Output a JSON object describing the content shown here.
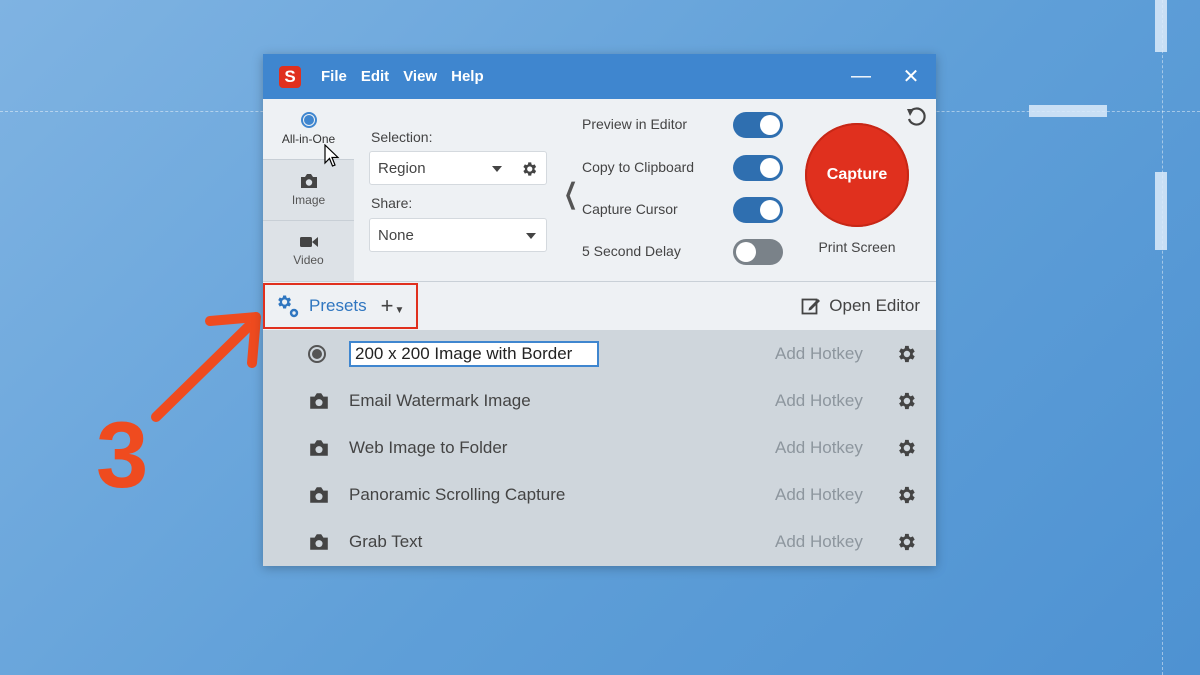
{
  "app": {
    "logo_letter": "S"
  },
  "menu": [
    "File",
    "Edit",
    "View",
    "Help"
  ],
  "window_controls": {
    "minimize": "—",
    "close": "✕"
  },
  "modes": [
    {
      "label": "All-in-One",
      "icon": "radio-icon",
      "active": true
    },
    {
      "label": "Image",
      "icon": "camera-icon",
      "active": false
    },
    {
      "label": "Video",
      "icon": "video-camera-icon",
      "active": false
    }
  ],
  "selection": {
    "label": "Selection:",
    "value": "Region"
  },
  "share": {
    "label": "Share:",
    "value": "None"
  },
  "options": [
    {
      "label": "Preview in Editor",
      "on": true
    },
    {
      "label": "Copy to Clipboard",
      "on": true
    },
    {
      "label": "Capture Cursor",
      "on": true
    },
    {
      "label": "5 Second Delay",
      "on": false
    }
  ],
  "capture": {
    "label": "Capture",
    "shortcut": "Print Screen"
  },
  "presets_bar": {
    "presets_label": "Presets",
    "add_label": "+",
    "open_editor_label": "Open Editor"
  },
  "presets": [
    {
      "name": "200 x 200 Image with Border",
      "hotkey": "Add Hotkey",
      "editing": true
    },
    {
      "name": "Email Watermark Image",
      "hotkey": "Add Hotkey",
      "editing": false
    },
    {
      "name": "Web Image to Folder",
      "hotkey": "Add Hotkey",
      "editing": false
    },
    {
      "name": "Panoramic Scrolling Capture",
      "hotkey": "Add Hotkey",
      "editing": false
    },
    {
      "name": "Grab Text",
      "hotkey": "Add Hotkey",
      "editing": false
    }
  ],
  "annotation": {
    "step_number": "3"
  },
  "colors": {
    "titlebar": "#3f86cf",
    "accent": "#e0301e",
    "toggle_on": "#2f6fb0",
    "annotation": "#ef4b1f"
  }
}
